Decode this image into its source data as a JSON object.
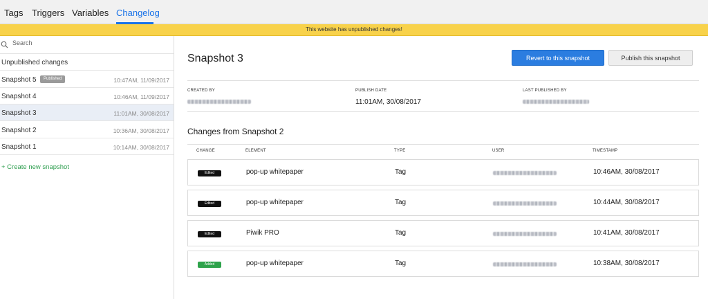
{
  "tabs": [
    {
      "label": "Tags"
    },
    {
      "label": "Triggers"
    },
    {
      "label": "Variables"
    },
    {
      "label": "Changelog",
      "active": true
    }
  ],
  "banner": {
    "text": "This website has unpublished changes!",
    "color": "#f8d24b"
  },
  "sidebar": {
    "search": {
      "placeholder": "Search",
      "value": ""
    },
    "unpublished_label": "Unpublished changes",
    "snapshots": [
      {
        "name": "Snapshot 5",
        "badge": "Published",
        "date": "10:47AM, 11/09/2017"
      },
      {
        "name": "Snapshot 4",
        "date": "10:46AM, 11/09/2017"
      },
      {
        "name": "Snapshot 3",
        "date": "11:01AM, 30/08/2017",
        "selected": true
      },
      {
        "name": "Snapshot 2",
        "date": "10:36AM, 30/08/2017"
      },
      {
        "name": "Snapshot 1",
        "date": "10:14AM, 30/08/2017"
      }
    ],
    "create_link": "+ Create new snapshot"
  },
  "main": {
    "title": "Snapshot 3",
    "revert_button": "Revert to this snapshot",
    "publish_button": "Publish this snapshot",
    "meta": {
      "created_by_label": "CREATED BY",
      "publish_date_label": "PUBLISH DATE",
      "publish_date_value": "11:01AM, 30/08/2017",
      "last_published_label": "LAST PUBLISHED BY"
    },
    "changes_title": "Changes from Snapshot 2",
    "columns": [
      "CHANGE",
      "ELEMENT",
      "TYPE",
      "USER",
      "TIMESTAMP"
    ],
    "rows": [
      {
        "change": "Edited",
        "element": "pop-up whitepaper",
        "type": "Tag",
        "timestamp": "10:46AM, 30/08/2017"
      },
      {
        "change": "Edited",
        "element": "pop-up whitepaper",
        "type": "Tag",
        "timestamp": "10:44AM, 30/08/2017"
      },
      {
        "change": "Edited",
        "element": "Piwik PRO",
        "type": "Tag",
        "timestamp": "10:41AM, 30/08/2017"
      },
      {
        "change": "Added",
        "element": "pop-up whitepaper",
        "type": "Tag",
        "timestamp": "10:38AM, 30/08/2017"
      }
    ]
  },
  "colors": {
    "accent": "#1a73e8",
    "primary_button": "#2b7de0",
    "edited_badge": "#111111",
    "added_badge": "#2ea34b",
    "create_link": "#2e9e4f"
  }
}
